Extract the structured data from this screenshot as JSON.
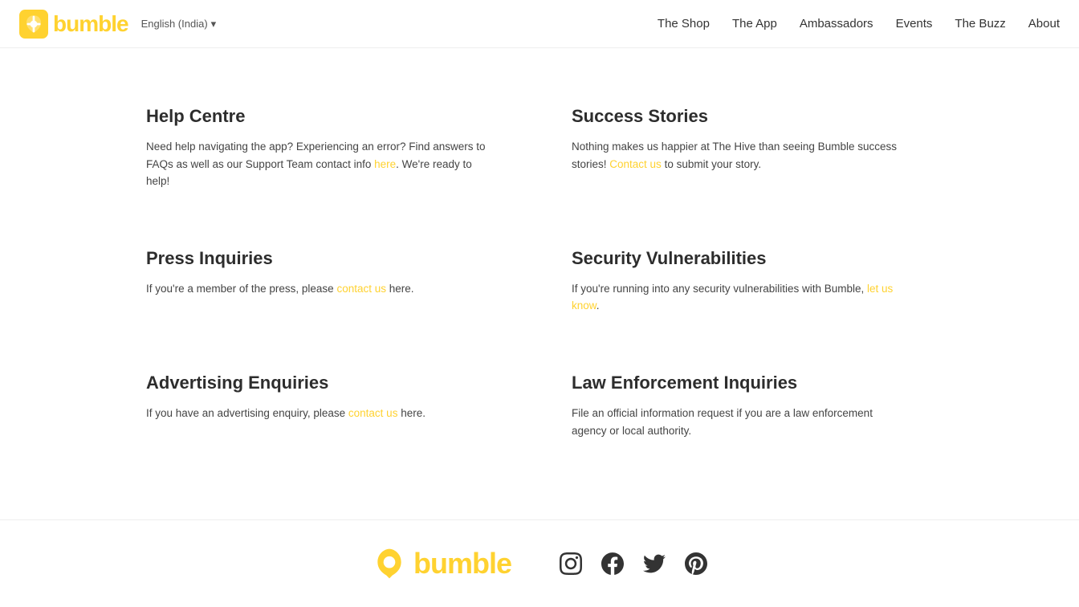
{
  "header": {
    "logo_text": "bumble",
    "lang": "English (India)",
    "nav_items": [
      {
        "label": "The Shop",
        "href": "#"
      },
      {
        "label": "The App",
        "href": "#"
      },
      {
        "label": "Ambassadors",
        "href": "#"
      },
      {
        "label": "Events",
        "href": "#"
      },
      {
        "label": "The Buzz",
        "href": "#"
      },
      {
        "label": "About",
        "href": "#"
      }
    ]
  },
  "main": {
    "cards": [
      {
        "id": "help-centre",
        "title": "Help Centre",
        "text_before_link": "Need help navigating the app? Experiencing an error? Find answers to FAQs as well as our Support Team contact info ",
        "link_text": "here",
        "text_after_link": ". We're ready to help!"
      },
      {
        "id": "success-stories",
        "title": "Success Stories",
        "text_before_link": "Nothing makes us happier at The Hive than seeing Bumble success stories! ",
        "link_text": "Contact us",
        "text_after_link": " to submit your story."
      },
      {
        "id": "press-inquiries",
        "title": "Press Inquiries",
        "text_before_link": "If you're a member of the press, please ",
        "link_text": "contact us",
        "text_after_link": " here."
      },
      {
        "id": "security-vulnerabilities",
        "title": "Security Vulnerabilities",
        "text_before_link": "If you're running into any security vulnerabilities with Bumble, ",
        "link_text": "let us know",
        "text_after_link": "."
      },
      {
        "id": "advertising-enquiries",
        "title": "Advertising Enquiries",
        "text_before_link": "If you have an advertising enquiry, please ",
        "link_text": "contact us",
        "text_after_link": " here."
      },
      {
        "id": "law-enforcement",
        "title": "Law Enforcement Inquiries",
        "text_before_link": "File an official information request if you are a law enforcement agency or local authority.",
        "link_text": "",
        "text_after_link": ""
      }
    ]
  },
  "footer": {
    "logo_text": "bumble",
    "social": [
      {
        "name": "instagram",
        "label": "Instagram"
      },
      {
        "name": "facebook",
        "label": "Facebook"
      },
      {
        "name": "twitter",
        "label": "Twitter"
      },
      {
        "name": "pinterest",
        "label": "Pinterest"
      }
    ]
  }
}
